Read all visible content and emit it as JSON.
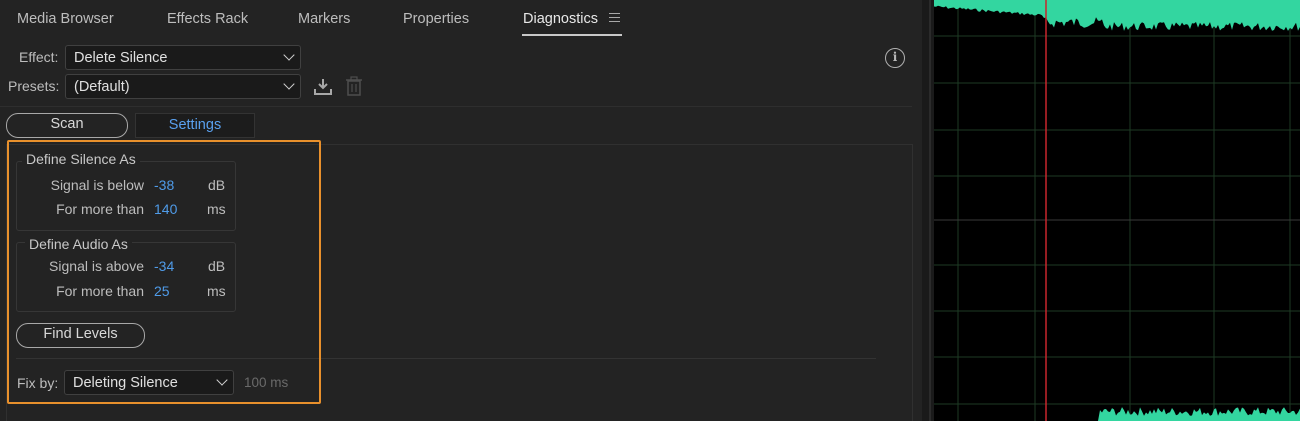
{
  "tabs": [
    {
      "label": "Media Browser"
    },
    {
      "label": "Effects Rack"
    },
    {
      "label": "Markers"
    },
    {
      "label": "Properties"
    },
    {
      "label": "Diagnostics",
      "active": true
    }
  ],
  "effect": {
    "label": "Effect:",
    "value": "Delete Silence"
  },
  "presets": {
    "label": "Presets:",
    "value": "(Default)"
  },
  "mode_buttons": {
    "scan": "Scan",
    "settings": "Settings"
  },
  "define_silence": {
    "title": "Define Silence As",
    "signal_label": "Signal is below",
    "signal_value": "-38",
    "signal_unit": "dB",
    "duration_label": "For more than",
    "duration_value": "140",
    "duration_unit": "ms"
  },
  "define_audio": {
    "title": "Define Audio As",
    "signal_label": "Signal is above",
    "signal_value": "-34",
    "signal_unit": "dB",
    "duration_label": "For more than",
    "duration_value": "25",
    "duration_unit": "ms"
  },
  "find_levels": "Find Levels",
  "fix_by": {
    "label": "Fix by:",
    "value": "Deleting Silence",
    "hint": "100 ms"
  },
  "colors": {
    "accent_blue": "#4f9be8",
    "highlight_orange": "#e8902c",
    "waveform_green": "#33d6a0",
    "playhead_red": "#c8262c",
    "grid_green": "#1e3a24"
  }
}
